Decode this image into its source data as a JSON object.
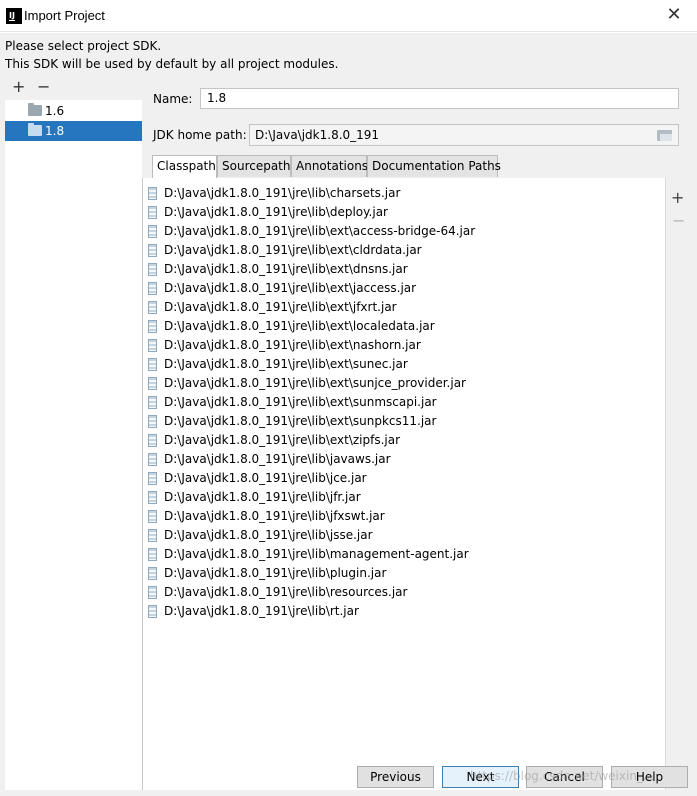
{
  "window": {
    "title": "Import Project",
    "close_glyph": "✕"
  },
  "description": {
    "line1": "Please select project SDK.",
    "line2": "This SDK will be used by default by all project modules."
  },
  "sdk_toolbar": {
    "add": "+",
    "remove": "−"
  },
  "sdk_list": [
    {
      "label": "1.6",
      "icon": "folder-icon"
    },
    {
      "label": "1.8",
      "icon": "folder-icon",
      "selected": true
    }
  ],
  "form": {
    "name_label": "Name:",
    "name_value": "1.8",
    "jdk_home_label": "JDK home path:",
    "jdk_home_value": "D:\\Java\\jdk1.8.0_191"
  },
  "tabs": [
    "Classpath",
    "Sourcepath",
    "Annotations",
    "Documentation Paths"
  ],
  "active_tab": "Classpath",
  "classpath": [
    "D:\\Java\\jdk1.8.0_191\\jre\\lib\\charsets.jar",
    "D:\\Java\\jdk1.8.0_191\\jre\\lib\\deploy.jar",
    "D:\\Java\\jdk1.8.0_191\\jre\\lib\\ext\\access-bridge-64.jar",
    "D:\\Java\\jdk1.8.0_191\\jre\\lib\\ext\\cldrdata.jar",
    "D:\\Java\\jdk1.8.0_191\\jre\\lib\\ext\\dnsns.jar",
    "D:\\Java\\jdk1.8.0_191\\jre\\lib\\ext\\jaccess.jar",
    "D:\\Java\\jdk1.8.0_191\\jre\\lib\\ext\\jfxrt.jar",
    "D:\\Java\\jdk1.8.0_191\\jre\\lib\\ext\\localedata.jar",
    "D:\\Java\\jdk1.8.0_191\\jre\\lib\\ext\\nashorn.jar",
    "D:\\Java\\jdk1.8.0_191\\jre\\lib\\ext\\sunec.jar",
    "D:\\Java\\jdk1.8.0_191\\jre\\lib\\ext\\sunjce_provider.jar",
    "D:\\Java\\jdk1.8.0_191\\jre\\lib\\ext\\sunmscapi.jar",
    "D:\\Java\\jdk1.8.0_191\\jre\\lib\\ext\\sunpkcs11.jar",
    "D:\\Java\\jdk1.8.0_191\\jre\\lib\\ext\\zipfs.jar",
    "D:\\Java\\jdk1.8.0_191\\jre\\lib\\javaws.jar",
    "D:\\Java\\jdk1.8.0_191\\jre\\lib\\jce.jar",
    "D:\\Java\\jdk1.8.0_191\\jre\\lib\\jfr.jar",
    "D:\\Java\\jdk1.8.0_191\\jre\\lib\\jfxswt.jar",
    "D:\\Java\\jdk1.8.0_191\\jre\\lib\\jsse.jar",
    "D:\\Java\\jdk1.8.0_191\\jre\\lib\\management-agent.jar",
    "D:\\Java\\jdk1.8.0_191\\jre\\lib\\plugin.jar",
    "D:\\Java\\jdk1.8.0_191\\jre\\lib\\resources.jar",
    "D:\\Java\\jdk1.8.0_191\\jre\\lib\\rt.jar"
  ],
  "classpath_toolbar": {
    "add": "+",
    "remove": "−"
  },
  "buttons": {
    "previous": "Previous",
    "next": "Next",
    "cancel": "Cancel",
    "help": "Help"
  },
  "watermark": "https://blog.csdn.net/weixin_..."
}
